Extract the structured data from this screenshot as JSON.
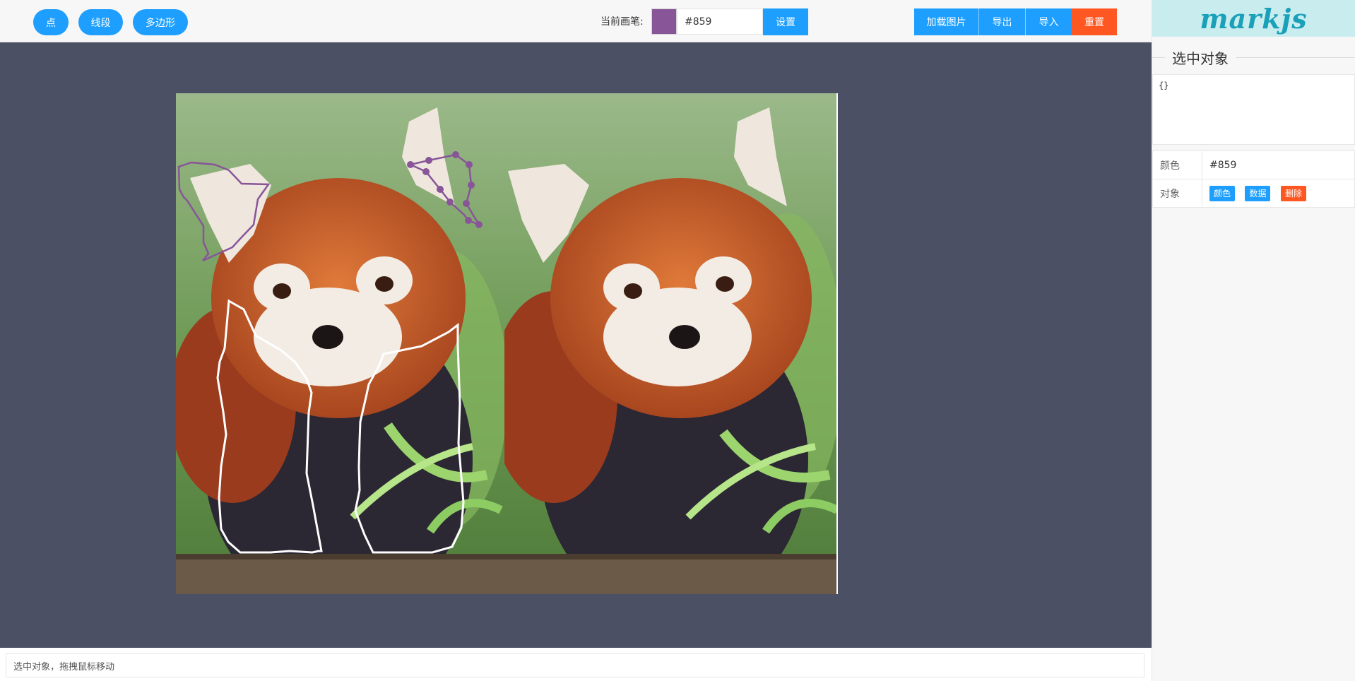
{
  "toolbar": {
    "point_label": "点",
    "segment_label": "线段",
    "polygon_label": "多边形",
    "pen_label": "当前画笔:",
    "pen_color": "#859",
    "set_label": "设置",
    "load_image_label": "加载图片",
    "export_label": "导出",
    "import_label": "导入",
    "reset_label": "重置"
  },
  "panel": {
    "logo": "markjs",
    "section_title": "选中对象",
    "json_value": "{}",
    "color_key": "颜色",
    "color_value": "#859",
    "object_key": "对象",
    "object_actions": [
      "颜色",
      "数据",
      "删除"
    ]
  },
  "status": {
    "text": "选中对象，拖拽鼠标移动"
  },
  "colors": {
    "accent": "#1e9fff",
    "danger": "#ff5722",
    "pen": "#885599",
    "canvas_bg": "#4b5064",
    "logo_bg": "#c9ecef",
    "logo_text": "#1aa0b8"
  }
}
